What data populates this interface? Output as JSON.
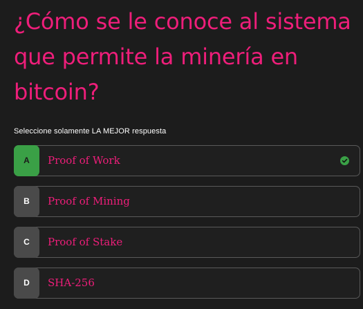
{
  "quiz": {
    "question": "¿Cómo se le conoce al sistema que permite la minería en bitcoin?",
    "instruction": "Seleccione solamente LA MEJOR respuesta",
    "options": [
      {
        "letter": "A",
        "label": "Proof of Work",
        "correct": true
      },
      {
        "letter": "B",
        "label": "Proof of Mining",
        "correct": false
      },
      {
        "letter": "C",
        "label": "Proof of Stake",
        "correct": false
      },
      {
        "letter": "D",
        "label": "SHA-256",
        "correct": false
      }
    ]
  },
  "colors": {
    "question_pink": "#ee1e7a",
    "correct_green": "#3aa046",
    "letter_gray": "#4a4a4a",
    "background": "#1c1c1c"
  },
  "icons": {
    "selected_indicator": "check-circle-icon"
  }
}
